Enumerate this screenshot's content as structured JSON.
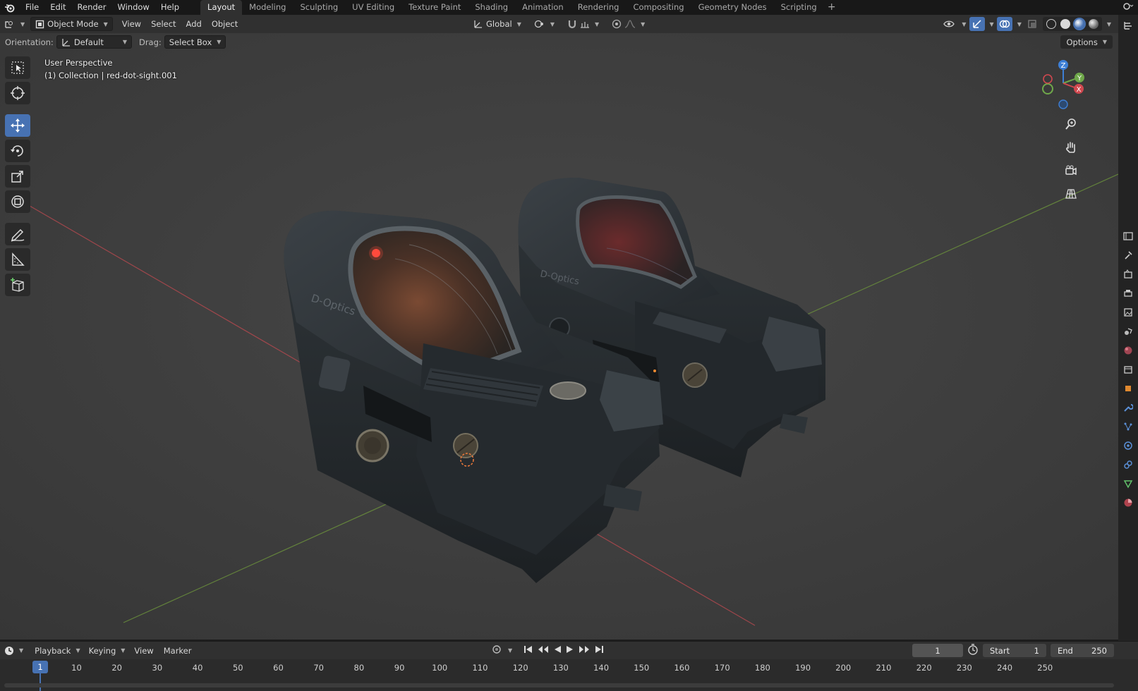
{
  "app": {
    "logo_icon": "blender-logo-icon"
  },
  "menu": [
    "File",
    "Edit",
    "Render",
    "Window",
    "Help"
  ],
  "workspaces": [
    "Layout",
    "Modeling",
    "Sculpting",
    "UV Editing",
    "Texture Paint",
    "Shading",
    "Animation",
    "Rendering",
    "Compositing",
    "Geometry Nodes",
    "Scripting"
  ],
  "active_workspace": "Layout",
  "workspace_add": "+",
  "header": {
    "mode": "Object Mode",
    "menus": [
      "View",
      "Select",
      "Add",
      "Object"
    ],
    "transform_orientation": "Global"
  },
  "tool_settings": {
    "orientation_label": "Orientation:",
    "orientation_value": "Default",
    "drag_label": "Drag:",
    "drag_value": "Select Box",
    "options": "Options"
  },
  "viewport": {
    "view_name": "User Perspective",
    "collection_info": "(1) Collection | red-dot-sight.001",
    "object_brand_text": "D-Optics",
    "gizmo_axes": [
      "Z",
      "Y",
      "X"
    ]
  },
  "toolbar_tools": [
    "select-box-icon",
    "cursor-icon",
    "move-icon",
    "rotate-icon",
    "scale-icon",
    "transform-icon",
    "annotate-icon",
    "measure-icon",
    "add-cube-icon"
  ],
  "active_tool": "move-icon",
  "timeline": {
    "menus": [
      "Playback",
      "Keying",
      "View",
      "Marker"
    ],
    "current_frame": "1",
    "start_label": "Start",
    "start_value": "1",
    "end_label": "End",
    "end_value": "250",
    "ticks": [
      "10",
      "20",
      "30",
      "40",
      "50",
      "60",
      "70",
      "80",
      "90",
      "100",
      "110",
      "120",
      "130",
      "140",
      "150",
      "160",
      "170",
      "180",
      "190",
      "200",
      "210",
      "220",
      "230",
      "240",
      "250"
    ]
  },
  "colors": {
    "accent": "#4772b3",
    "x_axis": "#d0484f",
    "y_axis": "#6fa84a",
    "z_axis": "#3d7fd6"
  }
}
